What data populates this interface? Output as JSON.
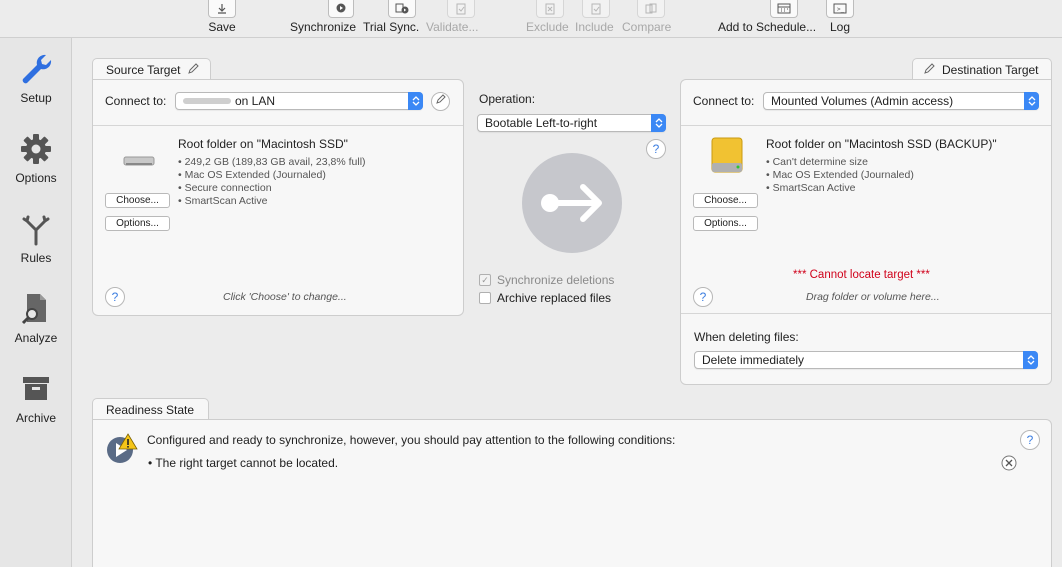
{
  "toolbar": {
    "save": "Save",
    "synchronize": "Synchronize",
    "trial_sync": "Trial Sync.",
    "validate": "Validate...",
    "exclude": "Exclude",
    "include": "Include",
    "compare": "Compare",
    "add_to_schedule": "Add to Schedule...",
    "log": "Log"
  },
  "sidebar": {
    "setup": "Setup",
    "options": "Options",
    "rules": "Rules",
    "analyze": "Analyze",
    "archive": "Archive"
  },
  "source": {
    "tab": "Source Target",
    "connect_label": "Connect to:",
    "connect_value": "on LAN",
    "title": "Root folder on \"Macintosh SSD\"",
    "details": [
      "249,2 GB (189,83 GB avail, 23,8% full)",
      "Mac OS Extended (Journaled)",
      "Secure connection",
      "SmartScan Active"
    ],
    "choose": "Choose...",
    "options": "Options...",
    "hint": "Click 'Choose' to change..."
  },
  "operation": {
    "label": "Operation:",
    "value": "Bootable Left-to-right",
    "sync_deletions": "Synchronize deletions",
    "archive_replaced": "Archive replaced files"
  },
  "destination": {
    "tab": "Destination Target",
    "connect_label": "Connect to:",
    "connect_value": "Mounted Volumes (Admin access)",
    "title": "Root folder on \"Macintosh SSD (BACKUP)\"",
    "details": [
      "Can't determine size",
      "Mac OS Extended (Journaled)",
      "SmartScan Active"
    ],
    "choose": "Choose...",
    "options": "Options...",
    "error": "*** Cannot locate target ***",
    "hint": "Drag folder or volume here...",
    "deleting_label": "When deleting files:",
    "deleting_value": "Delete immediately"
  },
  "readiness": {
    "tab": "Readiness State",
    "message": "Configured and ready to synchronize, however, you should pay attention to the following conditions:",
    "bullet": "• The right target cannot be located."
  },
  "colors": {
    "accent": "#3b88f5",
    "error": "#d0021b"
  },
  "help_glyph": "?"
}
